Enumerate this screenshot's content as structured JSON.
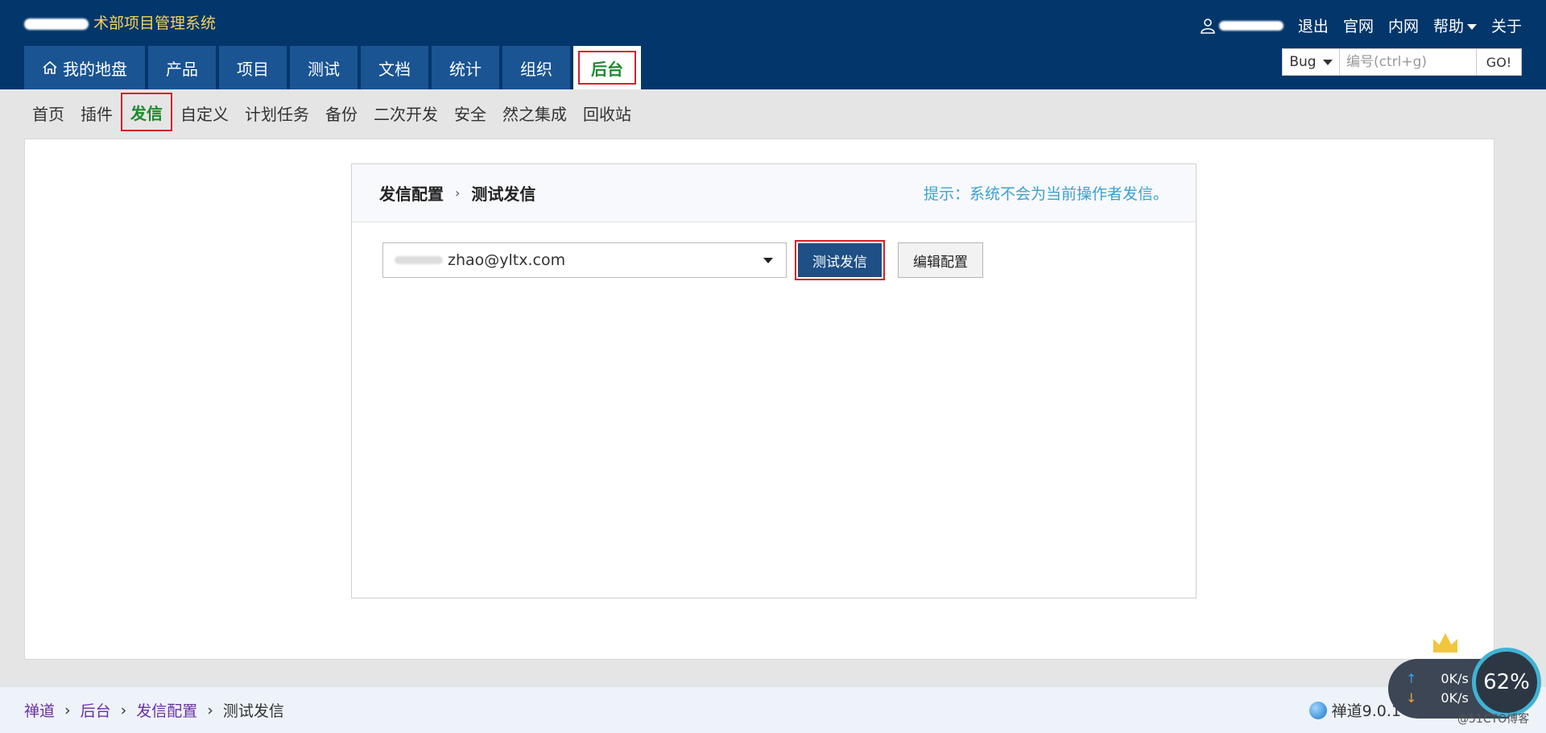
{
  "header": {
    "app_title": "术部项目管理系统",
    "top_links": [
      "退出",
      "官网",
      "内网",
      "帮助",
      "关于"
    ],
    "main_tabs": [
      "我的地盘",
      "产品",
      "项目",
      "测试",
      "文档",
      "统计",
      "组织",
      "后台"
    ],
    "active_tab": "后台",
    "search": {
      "type_label": "Bug",
      "placeholder": "编号(ctrl+g)",
      "go_label": "GO!"
    }
  },
  "sub_nav": {
    "items": [
      "首页",
      "插件",
      "发信",
      "自定义",
      "计划任务",
      "备份",
      "二次开发",
      "安全",
      "然之集成",
      "回收站"
    ],
    "active": "发信"
  },
  "panel": {
    "crumb_parent": "发信配置",
    "crumb_current": "测试发信",
    "tip": "提示：系统不会为当前操作者发信。",
    "recipient_value": "zhao@yltx.com",
    "test_button": "测试发信",
    "edit_button": "编辑配置"
  },
  "footer": {
    "breadcrumb": [
      "禅道",
      "后台",
      "发信配置",
      "测试发信"
    ],
    "version": "禅道9.0.1"
  },
  "speed_widget": {
    "up": "0K/s",
    "down": "0K/s",
    "percent": "62%"
  },
  "watermark": "@51CTO博客",
  "colors": {
    "header_bg": "#03366a",
    "tab_bg": "#1a5493",
    "active_green": "#1c8a2c",
    "highlight_red": "#d6202a",
    "button_blue": "#1e4f85",
    "tip_blue": "#3ba1cf"
  }
}
